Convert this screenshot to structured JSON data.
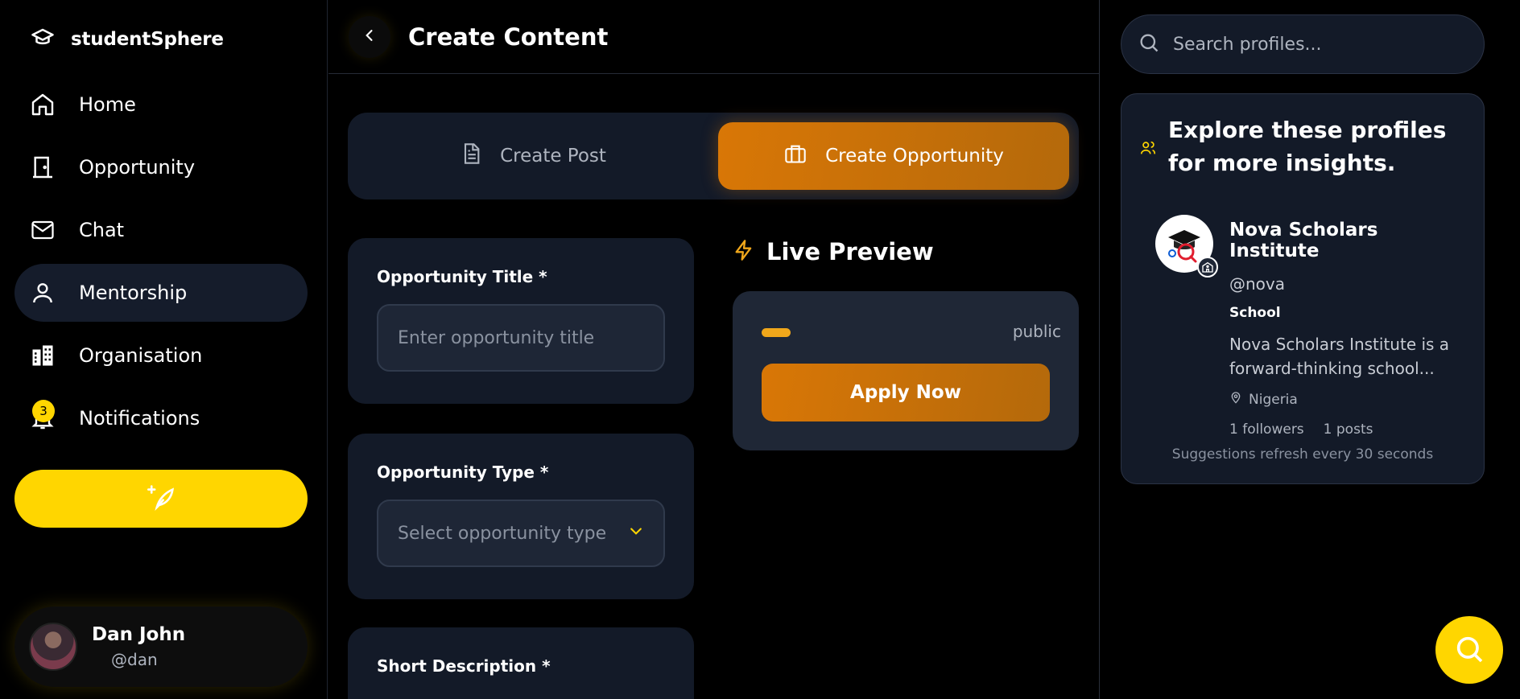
{
  "app": {
    "name": "studentSphere"
  },
  "nav": {
    "items": [
      {
        "label": "Home",
        "icon": "home-icon"
      },
      {
        "label": "Opportunity",
        "icon": "door-icon"
      },
      {
        "label": "Chat",
        "icon": "mail-icon"
      },
      {
        "label": "Mentorship",
        "icon": "user-icon",
        "active": true
      },
      {
        "label": "Organisation",
        "icon": "building-icon"
      },
      {
        "label": "Notifications",
        "icon": "bell-icon",
        "badge": "3"
      }
    ],
    "compose_icon": "feather-sparkle-icon"
  },
  "user": {
    "name": "Dan John",
    "handle": "@dan"
  },
  "header": {
    "title": "Create Content"
  },
  "tabs": [
    {
      "label": "Create Post",
      "icon": "document-icon",
      "active": false
    },
    {
      "label": "Create Opportunity",
      "icon": "briefcase-icon",
      "active": true
    }
  ],
  "form": {
    "title_label": "Opportunity Title *",
    "title_placeholder": "Enter opportunity title",
    "type_label": "Opportunity Type *",
    "type_placeholder": "Select opportunity type",
    "desc_label": "Short Description *"
  },
  "preview": {
    "title": "Live Preview",
    "visibility": "public",
    "apply_label": "Apply Now"
  },
  "search": {
    "placeholder": "Search profiles..."
  },
  "suggestions": {
    "title": "Explore these profiles for more insights.",
    "profiles": [
      {
        "name": "Nova Scholars Institute",
        "handle": "@nova",
        "type": "School",
        "description": "Nova Scholars Institute is a forward-thinking school...",
        "location": "Nigeria",
        "followers": "1 followers",
        "posts": "1 posts"
      }
    ],
    "refresh_note": "Suggestions refresh every 30 seconds"
  },
  "colors": {
    "accent_yellow": "#FFD600",
    "accent_orange": "#D97706",
    "card_bg": "#131A28"
  }
}
